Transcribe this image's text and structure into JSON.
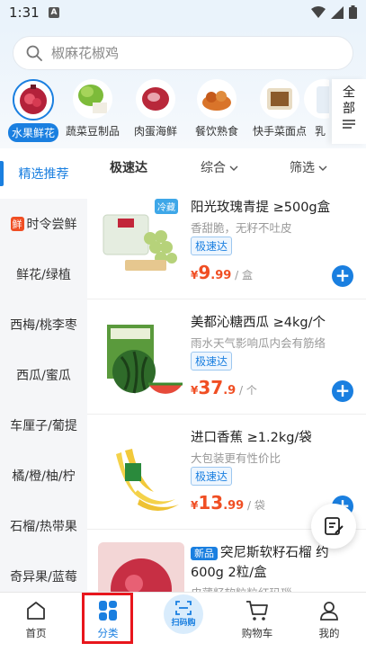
{
  "status_bar": {
    "time": "1:31",
    "notification_icon": "A"
  },
  "search": {
    "placeholder": "椒麻花椒鸡"
  },
  "categories": [
    {
      "label": "水果鲜花",
      "icon": "pomegranate-image",
      "active": true
    },
    {
      "label": "蔬菜豆制品",
      "icon": "vegetable-image"
    },
    {
      "label": "肉蛋海鲜",
      "icon": "meat-image"
    },
    {
      "label": "餐饮熟食",
      "icon": "cooked-food-image"
    },
    {
      "label": "快手菜面点",
      "icon": "quick-dish-image"
    },
    {
      "label": "乳",
      "icon": "dairy-image"
    }
  ],
  "all_button": {
    "line1": "全",
    "line2": "部"
  },
  "sidebar": [
    {
      "label": "精选推荐",
      "active": true
    },
    {
      "label": "时令尝鲜",
      "tag": "鲜"
    },
    {
      "label": "鲜花/绿植"
    },
    {
      "label": "西梅/桃李枣"
    },
    {
      "label": "西瓜/蜜瓜"
    },
    {
      "label": "车厘子/葡提"
    },
    {
      "label": "橘/橙/柚/柠"
    },
    {
      "label": "石榴/热带果"
    },
    {
      "label": "奇异果/蓝莓"
    }
  ],
  "filters": {
    "speed": "极速达",
    "sort": "综合",
    "filter": "筛选"
  },
  "products": [
    {
      "title": "阳光玫瑰青提 ≥500g盒",
      "subtitle": "香甜脆，无籽不吐皮",
      "badge": "极速达",
      "tag": "冷藏",
      "price_symbol": "¥",
      "price_int": "9",
      "price_dec": ".99",
      "unit": " / 盒"
    },
    {
      "title": "美都沁糖西瓜 ≥4kg/个",
      "subtitle": "雨水天气影响瓜内会有筋络",
      "badge": "极速达",
      "price_symbol": "¥",
      "price_int": "37",
      "price_dec": ".9",
      "unit": " / 个"
    },
    {
      "title": "进口香蕉 ≥1.2kg/袋",
      "subtitle": "大包装更有性价比",
      "badge": "极速达",
      "price_symbol": "¥",
      "price_int": "13",
      "price_dec": ".99",
      "unit": " / 袋"
    },
    {
      "title": "突尼斯软籽石榴 约",
      "title2": "600g 2粒/盒",
      "subtitle": "皮薄籽软粒粒红玛瑙",
      "tag": "新品"
    }
  ],
  "bottom_nav": {
    "home": "首页",
    "category": "分类",
    "scan": "扫码购",
    "cart": "购物车",
    "mine": "我的"
  },
  "colors": {
    "accent": "#1a7fe0",
    "price": "#f04e23",
    "highlight": "#e8161c"
  }
}
